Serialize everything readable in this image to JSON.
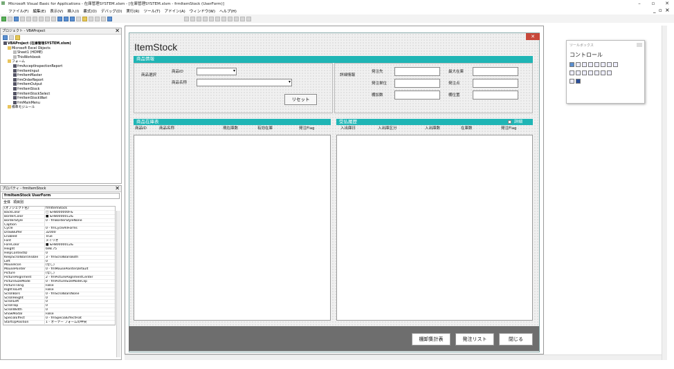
{
  "window": {
    "title": "Microsoft Visual Basic for Applications - 在庫管理SYSTEM.xlsm - [在庫管理SYSTEM.xlsm - frmItemStock (UserForm)]",
    "minimize": "–",
    "maximize": "▫",
    "close": "✕",
    "inner_min": "_",
    "inner_max": "▫",
    "inner_close": "×"
  },
  "menu": [
    "ファイル(F)",
    "編集(E)",
    "表示(V)",
    "挿入(I)",
    "書式(O)",
    "デバッグ(D)",
    "実行(R)",
    "ツール(T)",
    "アドイン(A)",
    "ウィンドウ(W)",
    "ヘルプ(H)"
  ],
  "project": {
    "title": "プロジェクト - VBAProject",
    "close": "✕",
    "items": [
      {
        "label": "VBAProject (在庫管理SYSTEM.xlsm)",
        "level": 0
      },
      {
        "label": "Microsoft Excel Objects",
        "level": 1
      },
      {
        "label": "Sheet1 (HOME)",
        "level": 2
      },
      {
        "label": "ThisWorkbook",
        "level": 2
      },
      {
        "label": "フォーム",
        "level": 1
      },
      {
        "label": "frmAcceptInspectionReport",
        "level": 2
      },
      {
        "label": "frmItemInput",
        "level": 2
      },
      {
        "label": "frmItemMaster",
        "level": 2
      },
      {
        "label": "frmOrderReport",
        "level": 2
      },
      {
        "label": "frmItemOutput",
        "level": 2
      },
      {
        "label": "frmItemStock",
        "level": 2
      },
      {
        "label": "frmItemStockSelect",
        "level": 2
      },
      {
        "label": "frmItemStockWari",
        "level": 2
      },
      {
        "label": "frmMainMenu",
        "level": 2
      },
      {
        "label": "標準モジュール",
        "level": 1
      }
    ]
  },
  "properties": {
    "title": "プロパティ - frmItemStock",
    "close": "✕",
    "object": "frmItemStock  UserForm",
    "tabs": [
      "全体",
      "項目別"
    ],
    "rows": [
      [
        "(オブジェクト名)",
        "frmItemStock"
      ],
      [
        "BackColor",
        "□ &H8000000F&"
      ],
      [
        "BorderColor",
        "■ &H80000012&"
      ],
      [
        "BorderStyle",
        "0 - fmBorderStyleNone"
      ],
      [
        "Caption",
        ""
      ],
      [
        "Cycle",
        "0 - fmCycleAllForms"
      ],
      [
        "DrawBuffer",
        "32000"
      ],
      [
        "Enabled",
        "True"
      ],
      [
        "Font",
        "メイリオ"
      ],
      [
        "ForeColor",
        "■ &H80000012&"
      ],
      [
        "Height",
        "698.75"
      ],
      [
        "HelpContextID",
        "0"
      ],
      [
        "KeepScrollBarsVisible",
        "3 - fmScrollBarsBoth"
      ],
      [
        "Left",
        "0"
      ],
      [
        "MouseIcon",
        "(なし)"
      ],
      [
        "MousePointer",
        "0 - fmMousePointerDefault"
      ],
      [
        "Picture",
        "(なし)"
      ],
      [
        "PictureAlignment",
        "2 - fmPictureAlignmentCenter"
      ],
      [
        "PictureSizeMode",
        "0 - fmPictureSizeModeClip"
      ],
      [
        "PictureTiling",
        "False"
      ],
      [
        "RightToLeft",
        "False"
      ],
      [
        "ScrollBars",
        "0 - fmScrollBarsNone"
      ],
      [
        "ScrollHeight",
        "0"
      ],
      [
        "ScrollLeft",
        "0"
      ],
      [
        "ScrollTop",
        "0"
      ],
      [
        "ScrollWidth",
        "0"
      ],
      [
        "ShowModal",
        "False"
      ],
      [
        "SpecialEffect",
        "0 - fmSpecialEffectFlat"
      ],
      [
        "StartUpPosition",
        "1 - オーナー フォームの中央"
      ]
    ]
  },
  "form": {
    "title": "ItemStock",
    "close": "✕",
    "info_header": "商品情報",
    "item_select_label": "商品選択",
    "item_id_label": "商品ID",
    "item_name_label": "商品名称",
    "reset_button": "リセット",
    "detail_label": "詳細情報",
    "detail_fields": {
      "supplier": "発注先",
      "order_unit": "発注単位",
      "shelf_no": "棚加数",
      "max_stock": "最大在庫",
      "order_point": "発注点",
      "shelf_position": "棚位置"
    },
    "stock_header": "商品在庫表",
    "stock_columns": [
      "商品ID",
      "商品名称",
      "現在庫数",
      "有効在庫",
      "発注Flag"
    ],
    "history_header": "受払履歴",
    "detail_check": "詳細",
    "history_columns": [
      "入出庫日",
      "入出庫区分",
      "入出庫数",
      "在庫数",
      "発注Flag"
    ],
    "buttons": {
      "shelf_total": "棚卸集計表",
      "order_list": "発注リスト",
      "close": "閉じる"
    }
  },
  "toolbox": {
    "title": "ツールボックス",
    "tab": "コントロール"
  },
  "colors": {
    "accent": "#1fb5b5",
    "footer": "#6e6e6e",
    "close_red": "#c8483a"
  }
}
